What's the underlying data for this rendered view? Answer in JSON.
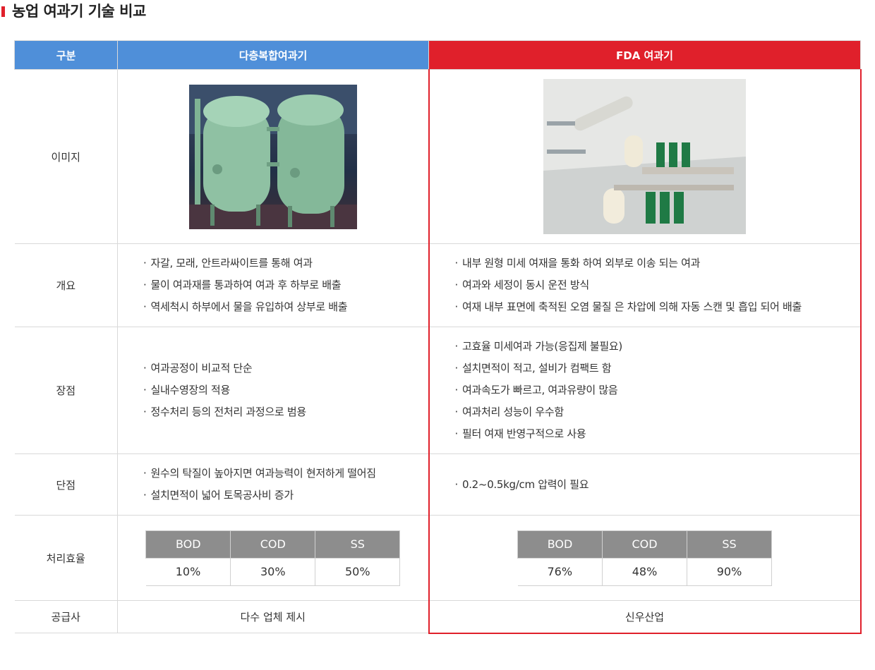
{
  "page": {
    "title": "농업 여과기 기술 비교"
  },
  "headers": {
    "category": "구분",
    "multi": "다층복합여과기",
    "fda": "FDA 여과기"
  },
  "colors": {
    "blue_header": "#4f8fd9",
    "red_accent": "#e0202b",
    "gray_header": "#8d8d8d"
  },
  "rows": {
    "image": {
      "label": "이미지"
    },
    "overview": {
      "label": "개요",
      "multi": [
        "자갈, 모래, 안트라싸이트를 통해 여과",
        "물이 여과재를 통과하여 여과 후 하부로 배출",
        "역세척시 하부에서 물을 유입하여 상부로 배출"
      ],
      "fda": [
        "내부 원형 미세 여재을 통화 하여 외부로 이송 되는 여과",
        "여과와 세정이 동시 운전 방식",
        "여재 내부 표면에 축적된 오염 물질 은 차압에 의해 자동 스캔 및 흡입 되어 배출"
      ]
    },
    "advantages": {
      "label": "장점",
      "multi": [
        "여과공정이 비교적 단순",
        "실내수영장의 적용",
        "정수처리 등의 전처리 과정으로 범용"
      ],
      "fda": [
        "고효율 미세여과 가능(응집제 불필요)",
        "설치면적이 적고, 설비가 컴팩트 함",
        "여과속도가 빠르고, 여과유량이 많음",
        "여과처리 성능이 우수함",
        "필터 여재 반영구적으로 사용"
      ]
    },
    "disadvantages": {
      "label": "단점",
      "multi": [
        "원수의 탁질이 높아지면 여과능력이 현저하게 떨어짐",
        "설치면적이 넓어 토목공사비 증가"
      ],
      "fda": [
        "0.2~0.5kg/cm 압력이 필요"
      ]
    },
    "efficiency": {
      "label": "처리효율",
      "columns": [
        "BOD",
        "COD",
        "SS"
      ],
      "multi": [
        "10%",
        "30%",
        "50%"
      ],
      "fda": [
        "76%",
        "48%",
        "90%"
      ]
    },
    "supplier": {
      "label": "공급사",
      "multi": "다수 업체 제시",
      "fda": "신우산업"
    }
  }
}
